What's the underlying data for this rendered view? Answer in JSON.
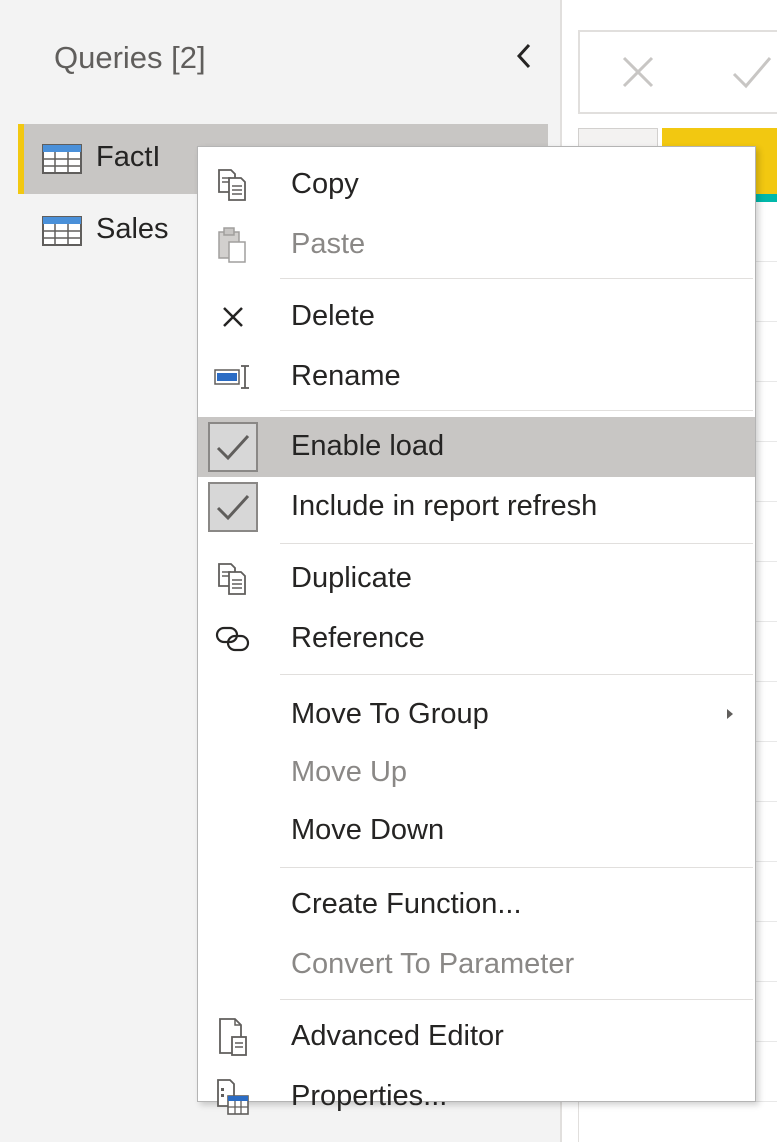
{
  "queries_pane": {
    "title": "Queries [2]",
    "items": [
      {
        "label": "FactI",
        "selected": true
      },
      {
        "label": "Sales",
        "selected": false
      }
    ]
  },
  "colors": {
    "accent_yellow": "#f2c811",
    "accent_teal": "#01b8aa",
    "highlight_gray": "#c8c6c4",
    "disabled_text": "#8a8886"
  },
  "context_menu": {
    "copy": "Copy",
    "paste": "Paste",
    "delete": "Delete",
    "rename": "Rename",
    "enable_load": "Enable load",
    "include_refresh": "Include in report refresh",
    "duplicate": "Duplicate",
    "reference": "Reference",
    "move_to_group": "Move To Group",
    "move_up": "Move Up",
    "move_down": "Move Down",
    "create_function": "Create Function...",
    "convert_to_parameter": "Convert To Parameter",
    "advanced_editor": "Advanced Editor",
    "properties": "Properties..."
  }
}
